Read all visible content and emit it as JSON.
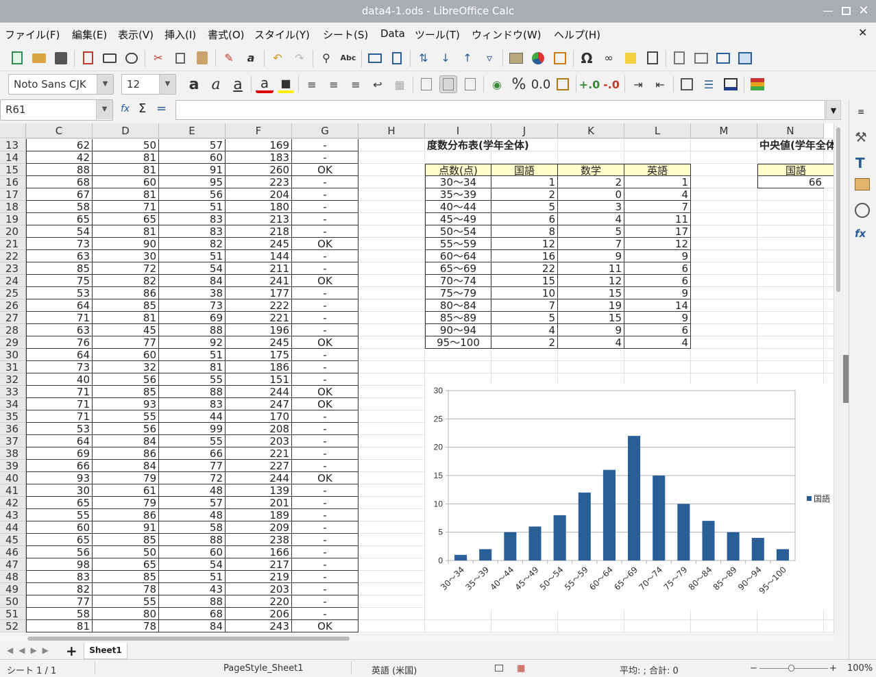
{
  "window": {
    "title": "data4-1.ods - LibreOffice Calc"
  },
  "menu": [
    "ファイル(F)",
    "編集(E)",
    "表示(V)",
    "挿入(I)",
    "書式(O)",
    "スタイル(Y)",
    "シート(S)",
    "Data",
    "ツール(T)",
    "ウィンドウ(W)",
    "ヘルプ(H)"
  ],
  "format_toolbar": {
    "font_name": "Noto Sans CJK",
    "font_size": "12",
    "percent": "%",
    "decimal": "0.0"
  },
  "formula_bar": {
    "cell_ref": "R61",
    "formula": ""
  },
  "columns": [
    "C",
    "D",
    "E",
    "F",
    "G",
    "H",
    "I",
    "J",
    "K",
    "L",
    "M",
    "N"
  ],
  "rows": [
    "13",
    "14",
    "15",
    "16",
    "17",
    "18",
    "19",
    "20",
    "21",
    "22",
    "23",
    "24",
    "25",
    "26",
    "27",
    "28",
    "29",
    "30",
    "31",
    "32",
    "33",
    "34",
    "35",
    "36",
    "37",
    "38",
    "39",
    "40",
    "41",
    "42",
    "43",
    "44",
    "45",
    "46",
    "47",
    "48",
    "49",
    "50",
    "51",
    "52"
  ],
  "left_table": [
    [
      "62",
      "50",
      "57",
      "169",
      "-"
    ],
    [
      "42",
      "81",
      "60",
      "183",
      "-"
    ],
    [
      "88",
      "81",
      "91",
      "260",
      "OK"
    ],
    [
      "68",
      "60",
      "95",
      "223",
      "-"
    ],
    [
      "67",
      "81",
      "56",
      "204",
      "-"
    ],
    [
      "58",
      "71",
      "51",
      "180",
      "-"
    ],
    [
      "65",
      "65",
      "83",
      "213",
      "-"
    ],
    [
      "54",
      "81",
      "83",
      "218",
      "-"
    ],
    [
      "73",
      "90",
      "82",
      "245",
      "OK"
    ],
    [
      "63",
      "30",
      "51",
      "144",
      "-"
    ],
    [
      "85",
      "72",
      "54",
      "211",
      "-"
    ],
    [
      "75",
      "82",
      "84",
      "241",
      "OK"
    ],
    [
      "53",
      "86",
      "38",
      "177",
      "-"
    ],
    [
      "64",
      "85",
      "73",
      "222",
      "-"
    ],
    [
      "71",
      "81",
      "69",
      "221",
      "-"
    ],
    [
      "63",
      "45",
      "88",
      "196",
      "-"
    ],
    [
      "76",
      "77",
      "92",
      "245",
      "OK"
    ],
    [
      "64",
      "60",
      "51",
      "175",
      "-"
    ],
    [
      "73",
      "32",
      "81",
      "186",
      "-"
    ],
    [
      "40",
      "56",
      "55",
      "151",
      "-"
    ],
    [
      "71",
      "85",
      "88",
      "244",
      "OK"
    ],
    [
      "71",
      "93",
      "83",
      "247",
      "OK"
    ],
    [
      "71",
      "55",
      "44",
      "170",
      "-"
    ],
    [
      "53",
      "56",
      "99",
      "208",
      "-"
    ],
    [
      "64",
      "84",
      "55",
      "203",
      "-"
    ],
    [
      "69",
      "86",
      "66",
      "221",
      "-"
    ],
    [
      "66",
      "84",
      "77",
      "227",
      "-"
    ],
    [
      "93",
      "79",
      "72",
      "244",
      "OK"
    ],
    [
      "30",
      "61",
      "48",
      "139",
      "-"
    ],
    [
      "65",
      "79",
      "57",
      "201",
      "-"
    ],
    [
      "55",
      "86",
      "48",
      "189",
      "-"
    ],
    [
      "60",
      "91",
      "58",
      "209",
      "-"
    ],
    [
      "65",
      "85",
      "88",
      "238",
      "-"
    ],
    [
      "56",
      "50",
      "60",
      "166",
      "-"
    ],
    [
      "98",
      "65",
      "54",
      "217",
      "-"
    ],
    [
      "83",
      "85",
      "51",
      "219",
      "-"
    ],
    [
      "82",
      "78",
      "43",
      "203",
      "-"
    ],
    [
      "77",
      "55",
      "88",
      "220",
      "-"
    ],
    [
      "58",
      "80",
      "68",
      "206",
      "-"
    ],
    [
      "81",
      "78",
      "84",
      "243",
      "OK"
    ]
  ],
  "freq_table": {
    "title": "度数分布表(学年全体)",
    "headers": [
      "点数(点)",
      "国語",
      "数学",
      "英語"
    ],
    "rows": [
      [
        "30～34",
        "1",
        "2",
        "1"
      ],
      [
        "35～39",
        "2",
        "0",
        "4"
      ],
      [
        "40～44",
        "5",
        "3",
        "7"
      ],
      [
        "45～49",
        "6",
        "4",
        "11"
      ],
      [
        "50～54",
        "8",
        "5",
        "17"
      ],
      [
        "55～59",
        "12",
        "7",
        "12"
      ],
      [
        "60～64",
        "16",
        "9",
        "9"
      ],
      [
        "65～69",
        "22",
        "11",
        "6"
      ],
      [
        "70～74",
        "15",
        "12",
        "6"
      ],
      [
        "75～79",
        "10",
        "15",
        "9"
      ],
      [
        "80～84",
        "7",
        "19",
        "14"
      ],
      [
        "85～89",
        "5",
        "15",
        "9"
      ],
      [
        "90～94",
        "4",
        "9",
        "6"
      ],
      [
        "95～100",
        "2",
        "4",
        "4"
      ]
    ]
  },
  "median": {
    "title": "中央値(学年全体",
    "header": "国語",
    "value": "66"
  },
  "chart_data": {
    "type": "bar",
    "categories": [
      "30～34",
      "35～39",
      "40～44",
      "45～49",
      "50～54",
      "55～59",
      "60～64",
      "65～69",
      "70～74",
      "75～79",
      "80～84",
      "85～89",
      "90～94",
      "95～100"
    ],
    "series": [
      {
        "name": "国語",
        "values": [
          1,
          2,
          5,
          6,
          8,
          12,
          16,
          22,
          15,
          10,
          7,
          5,
          4,
          2
        ],
        "color": "#2a5e97"
      }
    ],
    "ylim": [
      0,
      30
    ],
    "yticks": [
      "0",
      "5",
      "10",
      "15",
      "20",
      "25",
      "30"
    ],
    "grid": true,
    "legend": "right"
  },
  "sheet_tabs": [
    "Sheet1"
  ],
  "status": {
    "sheet": "シート 1 / 1",
    "page_style": "PageStyle_Sheet1",
    "language": "英語 (米国)",
    "summary": "平均: ; 合計: 0",
    "zoom": "100%"
  }
}
